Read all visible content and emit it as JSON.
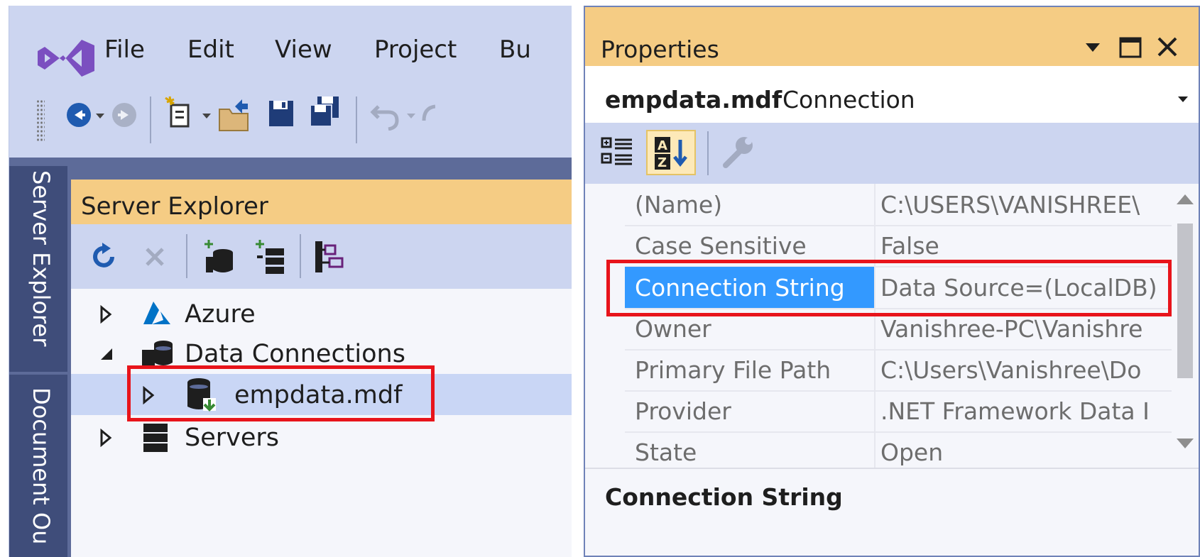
{
  "menu": {
    "items": [
      "File",
      "Edit",
      "View",
      "Project",
      "Bu"
    ]
  },
  "side_tabs": {
    "server_explorer": "Server Explorer",
    "document_outline": "Document Ou"
  },
  "server_explorer": {
    "title": "Server Explorer",
    "tree": [
      {
        "label": "Azure",
        "expanded": false,
        "icon": "azure-icon"
      },
      {
        "label": "Data Connections",
        "expanded": true,
        "icon": "data-connections-icon"
      },
      {
        "label": "empdata.mdf",
        "expanded": false,
        "icon": "database-icon",
        "selected": true
      },
      {
        "label": "Servers",
        "expanded": false,
        "icon": "servers-icon"
      }
    ]
  },
  "properties": {
    "title": "Properties",
    "object_name": "empdata.mdf",
    "object_type": "Connection",
    "rows": [
      {
        "name": "(Name)",
        "value": "C:\\USERS\\VANISHREE\\"
      },
      {
        "name": "Case Sensitive",
        "value": "False"
      },
      {
        "name": "Connection String",
        "value": "Data Source=(LocalDB)"
      },
      {
        "name": "Owner",
        "value": "Vanishree-PC\\Vanishre"
      },
      {
        "name": "Primary File Path",
        "value": "C:\\Users\\Vanishree\\Do"
      },
      {
        "name": "Provider",
        "value": ".NET Framework Data I"
      },
      {
        "name": "State",
        "value": "Open"
      }
    ],
    "selected_row": "Connection String",
    "description_title": "Connection String"
  },
  "colors": {
    "accent_title": "#f5cc84",
    "chrome": "#ccd5f0",
    "selection": "#3399ff",
    "highlight_box": "#e8141b",
    "vs_purple": "#68217a"
  }
}
